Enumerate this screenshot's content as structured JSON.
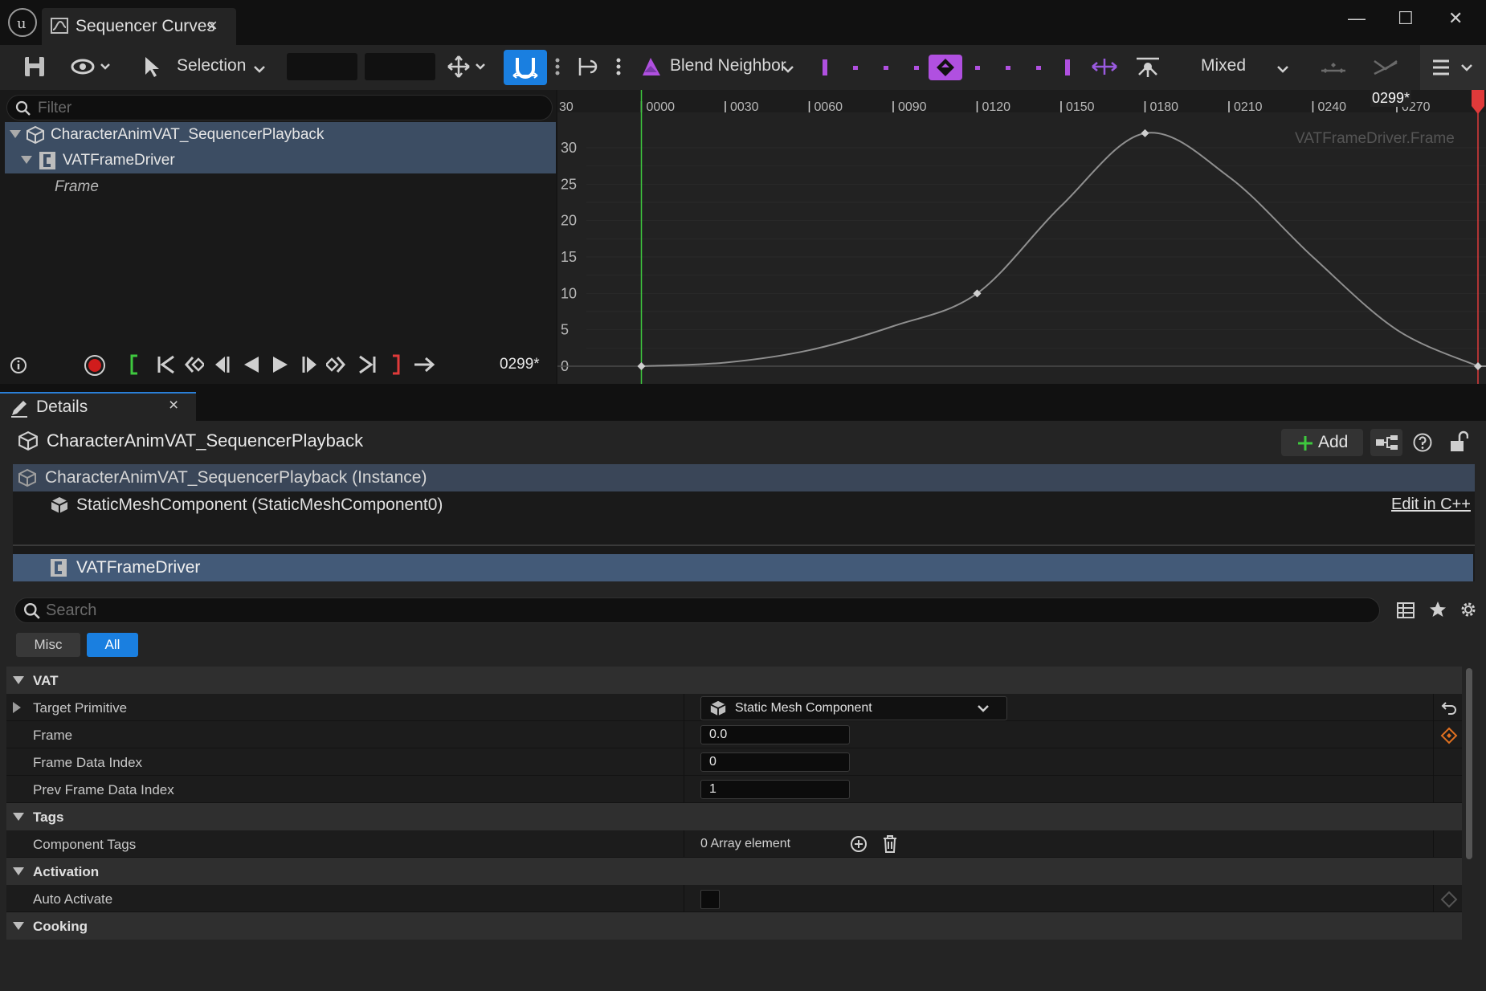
{
  "window": {
    "tab_title": "Sequencer Curves",
    "tab_close": "×",
    "min": "—",
    "max": "☐",
    "close": "✕"
  },
  "toolbar": {
    "selection_label": "Selection",
    "blend_label": "Blend Neighbor",
    "mode_label": "Mixed"
  },
  "tree": {
    "filter_placeholder": "Filter",
    "items": [
      {
        "label": "CharacterAnimVAT_SequencerPlayback"
      },
      {
        "label": "VATFrameDriver"
      },
      {
        "label": "Frame"
      }
    ]
  },
  "transport": {
    "current_time": "0299*"
  },
  "curve_editor": {
    "watermark": "VATFrameDriver.Frame",
    "playhead_label": "0299*"
  },
  "chart_data": {
    "type": "line",
    "x_ticks": [
      "30",
      "0000",
      "0030",
      "0060",
      "0090",
      "0120",
      "0150",
      "0180",
      "0210",
      "0240",
      "0270"
    ],
    "y_ticks": [
      "30",
      "25",
      "20",
      "15",
      "10",
      "5",
      "0"
    ],
    "xlim": [
      -30,
      299
    ],
    "ylim": [
      -2,
      33
    ],
    "x": [
      0,
      30,
      60,
      90,
      120,
      150,
      180,
      210,
      240,
      270,
      299
    ],
    "y": [
      0,
      0.5,
      2.2,
      5.5,
      10,
      22,
      32,
      26,
      15,
      5,
      0
    ],
    "keys": [
      {
        "x": 0,
        "y": 0
      },
      {
        "x": 120,
        "y": 10
      },
      {
        "x": 180,
        "y": 32
      },
      {
        "x": 299,
        "y": 0
      }
    ],
    "start_marker": 0,
    "end_marker": 299,
    "colors": {
      "curve": "#8f8f8f",
      "start": "#3ec83e",
      "end": "#e03a3a"
    }
  },
  "details": {
    "tab_title": "Details",
    "tab_close": "×",
    "actor_title": "CharacterAnimVAT_SequencerPlayback",
    "add_label": "Add",
    "components": [
      {
        "label": "CharacterAnimVAT_SequencerPlayback (Instance)"
      },
      {
        "label": "StaticMeshComponent (StaticMeshComponent0)"
      },
      {
        "label": "VATFrameDriver"
      }
    ],
    "edit_cpp": "Edit in C++",
    "search_placeholder": "Search",
    "filter_tabs": {
      "misc": "Misc",
      "all": "All"
    },
    "categories": {
      "vat": {
        "label": "VAT",
        "target_primitive": {
          "label": "Target Primitive",
          "value": "Static Mesh Component"
        },
        "frame": {
          "label": "Frame",
          "value": "0.0"
        },
        "frame_data_index": {
          "label": "Frame Data Index",
          "value": "0"
        },
        "prev_frame_data_index": {
          "label": "Prev Frame Data Index",
          "value": "1"
        }
      },
      "tags": {
        "label": "Tags",
        "component_tags": {
          "label": "Component Tags",
          "value": "0 Array element"
        }
      },
      "activation": {
        "label": "Activation",
        "auto_activate": {
          "label": "Auto Activate",
          "checked": false
        }
      },
      "cooking": {
        "label": "Cooking"
      }
    }
  },
  "colors": {
    "accent": "#1a7fe0",
    "selection": "#435a78",
    "key_diamond": "#e07020",
    "tangent_purple": "#b050e0"
  }
}
